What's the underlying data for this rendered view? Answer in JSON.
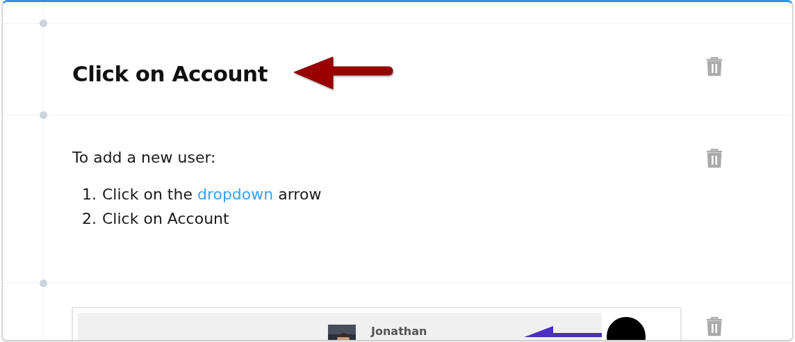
{
  "steps": [
    {
      "kind": "heading",
      "text": "Click on Account",
      "arrow": true
    },
    {
      "kind": "text",
      "intro": "To add a new user:",
      "items": [
        {
          "number": "1.",
          "before": "Click on the ",
          "link": "dropdown",
          "after": " arrow"
        },
        {
          "number": "2.",
          "before": "Click on Account"
        }
      ]
    },
    {
      "kind": "screenshot",
      "user_name": "Jonathan"
    }
  ]
}
